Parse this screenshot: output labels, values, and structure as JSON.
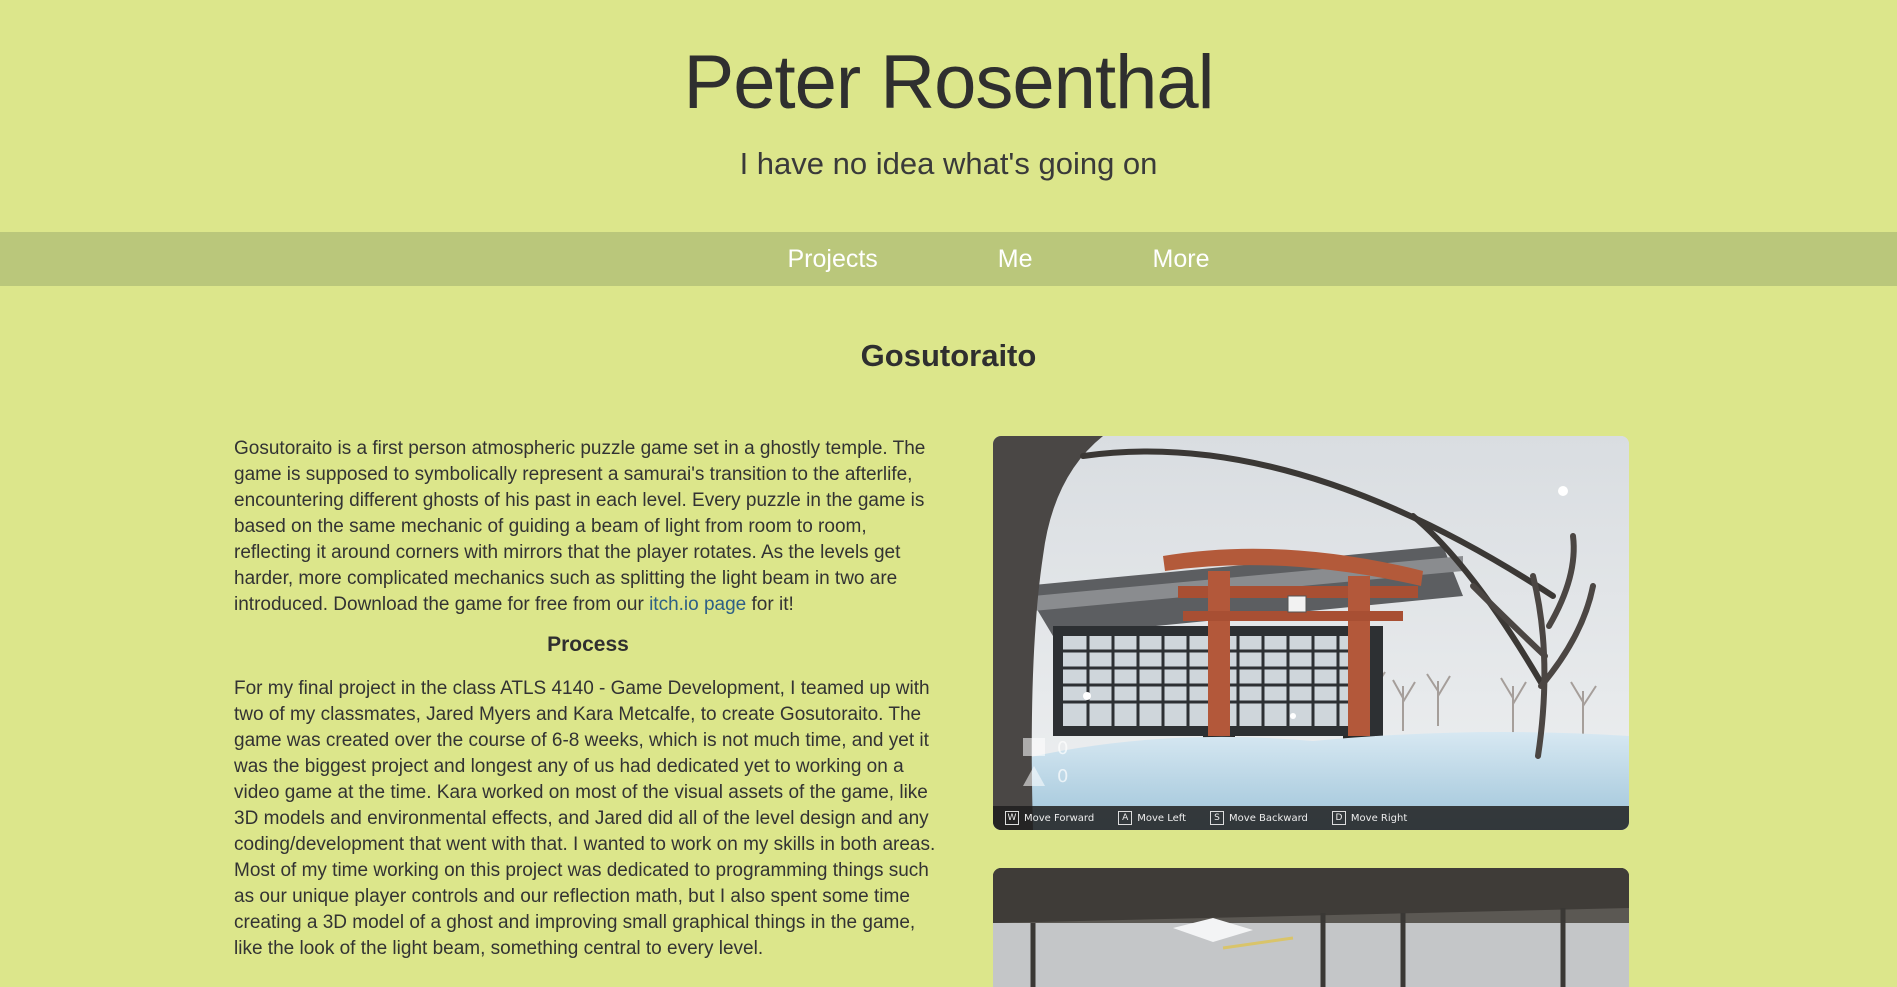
{
  "header": {
    "title": "Peter Rosenthal",
    "subtitle": "I have no idea what's going on"
  },
  "nav": {
    "items": [
      {
        "label": "Projects"
      },
      {
        "label": "Me"
      },
      {
        "label": "More"
      }
    ]
  },
  "project": {
    "title": "Gosutoraito",
    "intro_text": "Gosutoraito is a first person atmospheric puzzle game set in a ghostly temple. The game is supposed to symbolically represent a samurai's transition to the afterlife, encountering different ghosts of his past in each level. Every puzzle in the game is based on the same mechanic of guiding a beam of light from room to room, reflecting it around corners with mirrors that the player rotates. As the levels get harder, more complicated mechanics such as splitting the light beam in two are introduced. Download the game for free from our ",
    "link_text": "itch.io page",
    "intro_suffix": " for it!",
    "process_heading": "Process",
    "process_text": "For my final project in the class ATLS 4140 - Game Development, I teamed up with two of my classmates, Jared Myers and Kara Metcalfe, to create Gosutoraito. The game was created over the course of 6-8 weeks, which is not much time, and yet it was the biggest project and longest any of us had dedicated yet to working on a video game at the time. Kara worked on most of the visual assets of the game, like 3D models and environmental effects, and Jared did all of the level design and any coding/development that went with that. I wanted to work on my skills in both areas. Most of my time working on this project was dedicated to programming things such as our unique player controls and our reflection math, but I also spent some time creating a 3D model of a ghost and improving small graphical things in the game, like the look of the light beam, something central to every level."
  },
  "screenshot_hud": {
    "counters": [
      "0",
      "0"
    ],
    "controls": [
      {
        "key": "W",
        "label": "Move Forward"
      },
      {
        "key": "A",
        "label": "Move Left"
      },
      {
        "key": "S",
        "label": "Move Backward"
      },
      {
        "key": "D",
        "label": "Move Right"
      }
    ]
  }
}
